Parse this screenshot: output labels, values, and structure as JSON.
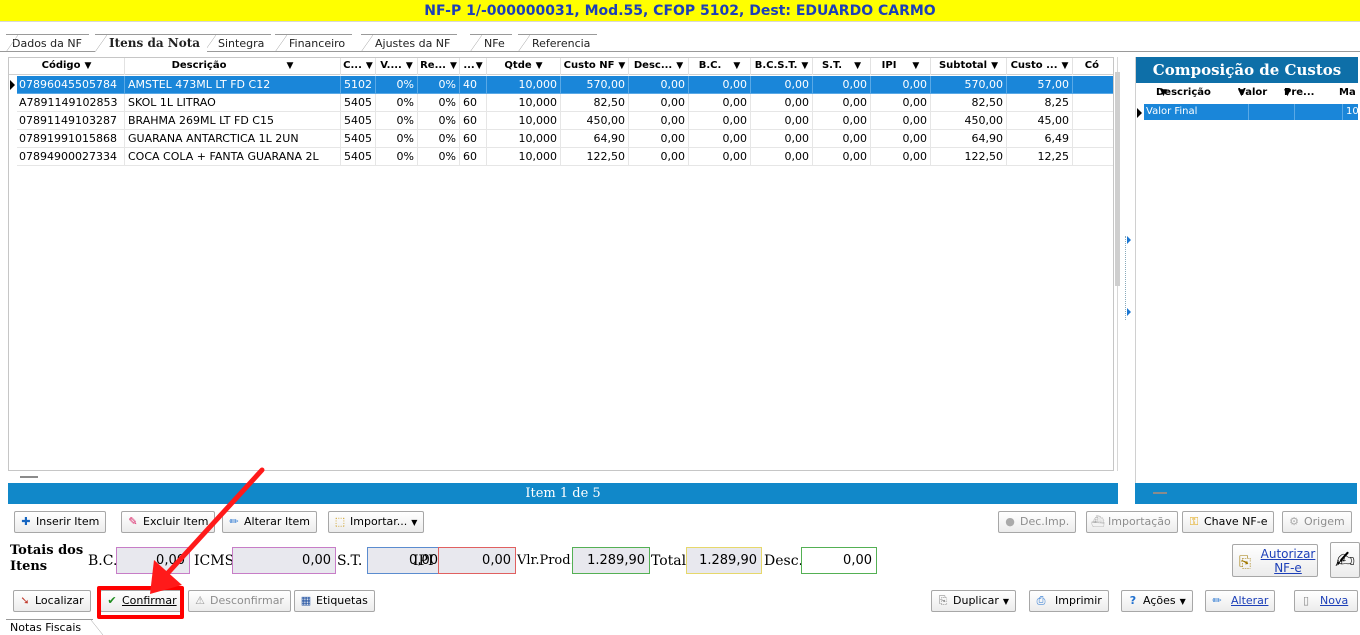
{
  "window": {
    "title": "NF-P 1/-000000031, Mod.55, CFOP 5102, Dest: EDUARDO CARMO"
  },
  "tabs": [
    {
      "label": "Dados da NF",
      "active": false
    },
    {
      "label": "Itens da Nota",
      "active": true
    },
    {
      "label": "Sintegra",
      "active": false
    },
    {
      "label": "Financeiro",
      "active": false
    },
    {
      "label": "Ajustes da NF",
      "active": false
    },
    {
      "label": "NFe",
      "active": false
    },
    {
      "label": "Referencia",
      "active": false
    }
  ],
  "grid": {
    "columns": [
      "Código",
      "Descrição",
      "C...",
      "V....",
      "Re...",
      "...",
      "Qtde",
      "Custo NF",
      "Desc...",
      "B.C.",
      "B.C.S.T.",
      "S.T.",
      "IPI",
      "Subtotal",
      "Custo ...",
      "Có"
    ],
    "rows": [
      [
        "07896045505784",
        "AMSTEL 473ML LT FD C12",
        "5102",
        "0%",
        "0%",
        "40",
        "10,000",
        "570,00",
        "0,00",
        "0,00",
        "0,00",
        "0,00",
        "0,00",
        "570,00",
        "57,00"
      ],
      [
        "A7891149102853",
        "SKOL 1L LITRAO",
        "5405",
        "0%",
        "0%",
        "60",
        "10,000",
        "82,50",
        "0,00",
        "0,00",
        "0,00",
        "0,00",
        "0,00",
        "82,50",
        "8,25"
      ],
      [
        "07891149103287",
        "BRAHMA 269ML LT FD C15",
        "5405",
        "0%",
        "0%",
        "60",
        "10,000",
        "450,00",
        "0,00",
        "0,00",
        "0,00",
        "0,00",
        "0,00",
        "450,00",
        "45,00"
      ],
      [
        "07891991015868",
        "GUARANA ANTARCTICA 1L 2UN",
        "5405",
        "0%",
        "0%",
        "60",
        "10,000",
        "64,90",
        "0,00",
        "0,00",
        "0,00",
        "0,00",
        "0,00",
        "64,90",
        "6,49"
      ],
      [
        "07894900027334",
        "COCA COLA + FANTA GUARANA 2L",
        "5405",
        "0%",
        "0%",
        "60",
        "10,000",
        "122,50",
        "0,00",
        "0,00",
        "0,00",
        "0,00",
        "0,00",
        "122,50",
        "12,25"
      ]
    ],
    "status": "Item 1 de 5"
  },
  "side_panel": {
    "title": "Composição de Custos",
    "columns": [
      "Descrição",
      "Valor",
      "Pre...",
      "Ma"
    ],
    "rows": [
      {
        "desc": "Valor Final",
        "ma": "10"
      }
    ]
  },
  "item_toolbar": {
    "inserir": "Inserir Item",
    "excluir": "Excluir Item",
    "alterar": "Alterar Item",
    "importar": "Importar...",
    "dec_imp": "Dec.Imp.",
    "importacao": "Importação",
    "chave": "Chave NF-e",
    "origem": "Origem"
  },
  "totals": {
    "label": "Totais dos Itens",
    "bc_label": "B.C.",
    "bc_value": "0,00",
    "icms_label": "ICMS",
    "icms_value": "0,00",
    "st_label": "S.T.",
    "st_value": "0,00",
    "ipi_label": "IPI",
    "ipi_value": "0,00",
    "vlprod_label": "Vlr.Prod.",
    "vlprod_value": "1.289,90",
    "total_label": "Total",
    "total_value": "1.289,90",
    "desc_label": "Desc.",
    "desc_value": "0,00"
  },
  "autorizar": "Autorizar NF-e",
  "bottom_toolbar": {
    "localizar": "Localizar",
    "confirmar": "Confirmar",
    "desconfirmar": "Desconfirmar",
    "etiquetas": "Etiquetas",
    "duplicar": "Duplicar",
    "imprimir": "Imprimir",
    "acoes": "Ações",
    "alterar": "Alterar",
    "nova": "Nova"
  },
  "bottom_tab": "Notas Fiscais",
  "colors": {
    "accent": "#1188c9",
    "selection": "#1a86d9",
    "title_bg": "#ffff00",
    "highlight": "#ff0000"
  }
}
